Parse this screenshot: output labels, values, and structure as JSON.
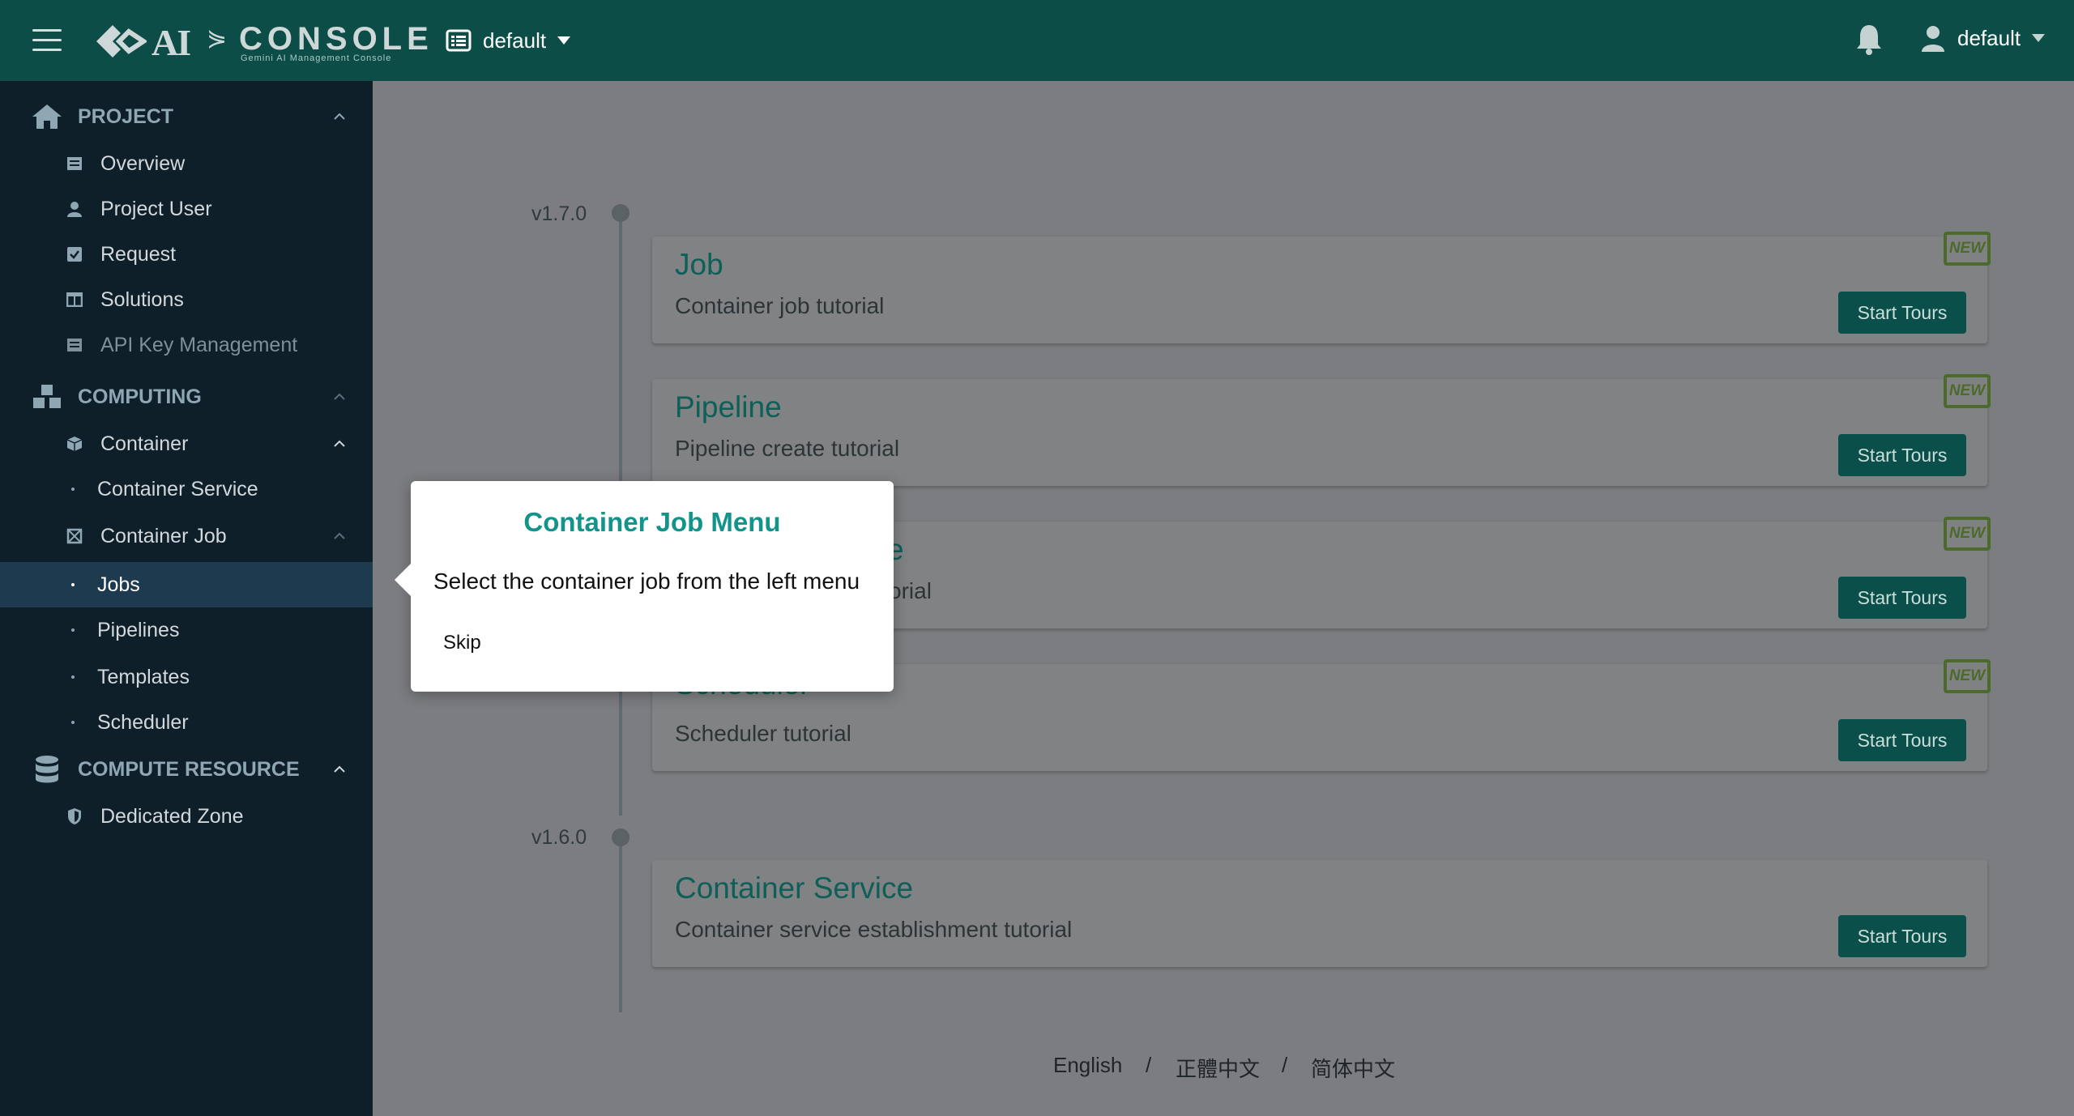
{
  "topbar": {
    "logo_text": "AI",
    "logo_console": "CONSOLE",
    "logo_sub": "Gemini AI Management Console",
    "project": "default",
    "user": "default"
  },
  "sidebar": {
    "sections": [
      {
        "label": "PROJECT",
        "icon": "home-icon"
      },
      {
        "label": "COMPUTING",
        "icon": "cubes-icon"
      },
      {
        "label": "COMPUTE RESOURCE",
        "icon": "database-icon"
      }
    ],
    "items": {
      "overview": "Overview",
      "project_user": "Project User",
      "request": "Request",
      "solutions": "Solutions",
      "api_key": "API Key Management",
      "container": "Container",
      "container_service": "Container Service",
      "container_job": "Container Job",
      "jobs": "Jobs",
      "pipelines": "Pipelines",
      "templates": "Templates",
      "scheduler": "Scheduler",
      "dedicated_zone": "Dedicated Zone"
    }
  },
  "timeline": {
    "versions": [
      "v1.7.0",
      "v1.6.0"
    ],
    "cards": [
      {
        "title": "Job",
        "desc": "Container job tutorial",
        "button": "Start Tours",
        "badge": "NEW"
      },
      {
        "title": "Pipeline",
        "desc": "Pipeline create tutorial",
        "button": "Start Tours",
        "badge": "NEW"
      },
      {
        "title": "e",
        "desc": "orial",
        "button": "Start Tours",
        "badge": "NEW"
      },
      {
        "title": "Scheduler",
        "desc": "Scheduler tutorial",
        "button": "Start Tours",
        "badge": "NEW"
      },
      {
        "title": "Container Service",
        "desc": "Container service establishment tutorial",
        "button": "Start Tours"
      }
    ]
  },
  "languages": [
    "English",
    "/",
    "正體中文",
    "/",
    "简体中文"
  ],
  "popover": {
    "title": "Container Job Menu",
    "body": "Select the container job from the left menu",
    "skip": "Skip"
  },
  "colors": {
    "topbar": "#0c4d47",
    "sidebar": "#0e1f2a",
    "accent": "#12948a",
    "button": "#0a4f49"
  }
}
